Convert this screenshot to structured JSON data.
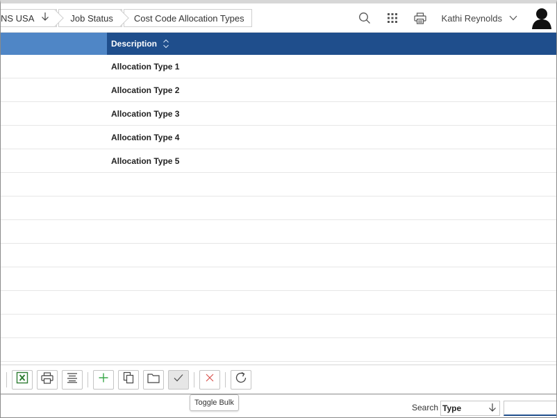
{
  "breadcrumbs": [
    {
      "label": "NS USA",
      "has_dropdown": true
    },
    {
      "label": "Job Status"
    },
    {
      "label": "Cost Code Allocation Types"
    }
  ],
  "header": {
    "user_name": "Kathi Reynolds",
    "icons": [
      "search-icon",
      "apps-grid-icon",
      "print-icon",
      "chevron-down-icon",
      "user-avatar-icon"
    ]
  },
  "grid": {
    "columns": [
      {
        "label": ""
      },
      {
        "label": "Description",
        "sortable": true
      }
    ],
    "rows": [
      {
        "description": "Allocation Type 1"
      },
      {
        "description": "Allocation Type 2"
      },
      {
        "description": "Allocation Type 3"
      },
      {
        "description": "Allocation Type 4"
      },
      {
        "description": "Allocation Type 5"
      },
      {
        "description": ""
      },
      {
        "description": ""
      },
      {
        "description": ""
      },
      {
        "description": ""
      },
      {
        "description": ""
      },
      {
        "description": ""
      },
      {
        "description": ""
      },
      {
        "description": ""
      }
    ]
  },
  "toolbar": {
    "buttons": [
      "export-excel-icon",
      "print-icon",
      "column-options-icon",
      "add-icon",
      "copy-icon",
      "open-folder-icon",
      "toggle-bulk-icon",
      "delete-icon",
      "refresh-icon"
    ],
    "tooltip": "Toggle Bulk"
  },
  "search": {
    "label": "Search",
    "field_value": "Type",
    "input_value": ""
  },
  "colors": {
    "header_dark": "#1f4e8c",
    "header_light": "#4f86c6",
    "add_green": "#3aa84a",
    "delete_red": "#d9534f",
    "excel_green": "#2e7d32"
  }
}
